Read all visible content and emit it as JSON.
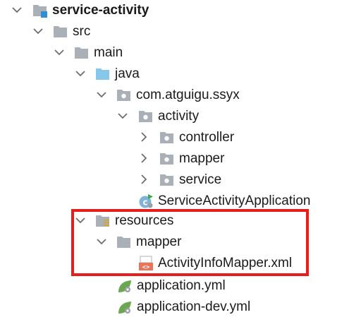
{
  "tree": {
    "root": {
      "label": "service-activity",
      "expanded": true,
      "icon": "module-folder-icon"
    },
    "src": {
      "label": "src",
      "expanded": true,
      "icon": "folder-icon"
    },
    "main": {
      "label": "main",
      "expanded": true,
      "icon": "folder-icon"
    },
    "java": {
      "label": "java",
      "expanded": true,
      "icon": "source-root-folder-icon"
    },
    "pkg": {
      "label": "com.atguigu.ssyx",
      "expanded": true,
      "icon": "package-icon"
    },
    "activity": {
      "label": "activity",
      "expanded": true,
      "icon": "package-icon"
    },
    "controller": {
      "label": "controller",
      "expanded": false,
      "icon": "package-icon"
    },
    "mapper_pkg": {
      "label": "mapper",
      "expanded": false,
      "icon": "package-icon"
    },
    "service": {
      "label": "service",
      "expanded": false,
      "icon": "package-icon"
    },
    "app_class": {
      "label": "ServiceActivityApplication",
      "icon": "spring-boot-class-icon"
    },
    "resources": {
      "label": "resources",
      "expanded": true,
      "icon": "resources-folder-icon"
    },
    "mapper_dir": {
      "label": "mapper",
      "expanded": true,
      "icon": "folder-icon"
    },
    "mapper_xml": {
      "label": "ActivityInfoMapper.xml",
      "icon": "xml-file-icon"
    },
    "app_yml": {
      "label": "application.yml",
      "icon": "spring-yml-icon"
    },
    "app_dev_yml": {
      "label": "application-dev.yml",
      "icon": "spring-yml-icon"
    }
  },
  "colors": {
    "highlight": "#e81d1d",
    "folder": "#a9b0b7",
    "source_root": "#87c7ea",
    "xml": "#e8745a",
    "spring": "#6aa84f"
  }
}
